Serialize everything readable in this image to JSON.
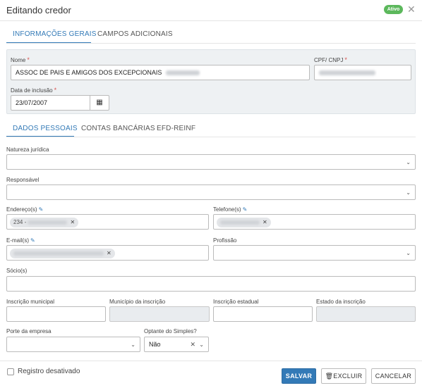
{
  "dialog": {
    "title": "Editando credor",
    "status_badge": "Ativo",
    "close_icon": "close-icon"
  },
  "main_tabs": [
    {
      "label": "INFORMAÇÕES GERAIS",
      "active": true
    },
    {
      "label": "CAMPOS ADICIONAIS",
      "active": false
    }
  ],
  "general": {
    "name_label": "Nome",
    "name_value": "ASSOC DE PAIS E AMIGOS DOS EXCEPCIONAIS",
    "cpf_label": "CPF/ CNPJ",
    "date_label": "Data de inclusão",
    "date_value": "23/07/2007"
  },
  "sub_tabs": [
    {
      "label": "DADOS PESSOAIS",
      "active": true
    },
    {
      "label": "CONTAS BANCÁRIAS",
      "active": false
    },
    {
      "label": "EFD-REINF",
      "active": false
    }
  ],
  "fields": {
    "natureza": "Natureza jurídica",
    "responsavel": "Responsável",
    "endereco": "Endereço(s)",
    "endereco_chip_prefix": "234 -",
    "telefone": "Telefone(s)",
    "email": "E-mail(s)",
    "profissao": "Profissão",
    "socios": "Sócio(s)",
    "inscricao_municipal": "Inscrição municipal",
    "municipio_inscricao": "Município da inscrição",
    "inscricao_estadual": "Inscrição estadual",
    "estado_inscricao": "Estado da inscrição",
    "porte": "Porte da empresa",
    "optante": "Optante do Simples?",
    "optante_value": "Não"
  },
  "footer": {
    "disabled_label": "Registro desativado",
    "save": "SALVAR",
    "delete": "EXCLUIR",
    "cancel": "CANCELAR"
  },
  "colors": {
    "primary": "#337ab7",
    "status_green": "#5cb85c",
    "required": "#d9534f"
  }
}
